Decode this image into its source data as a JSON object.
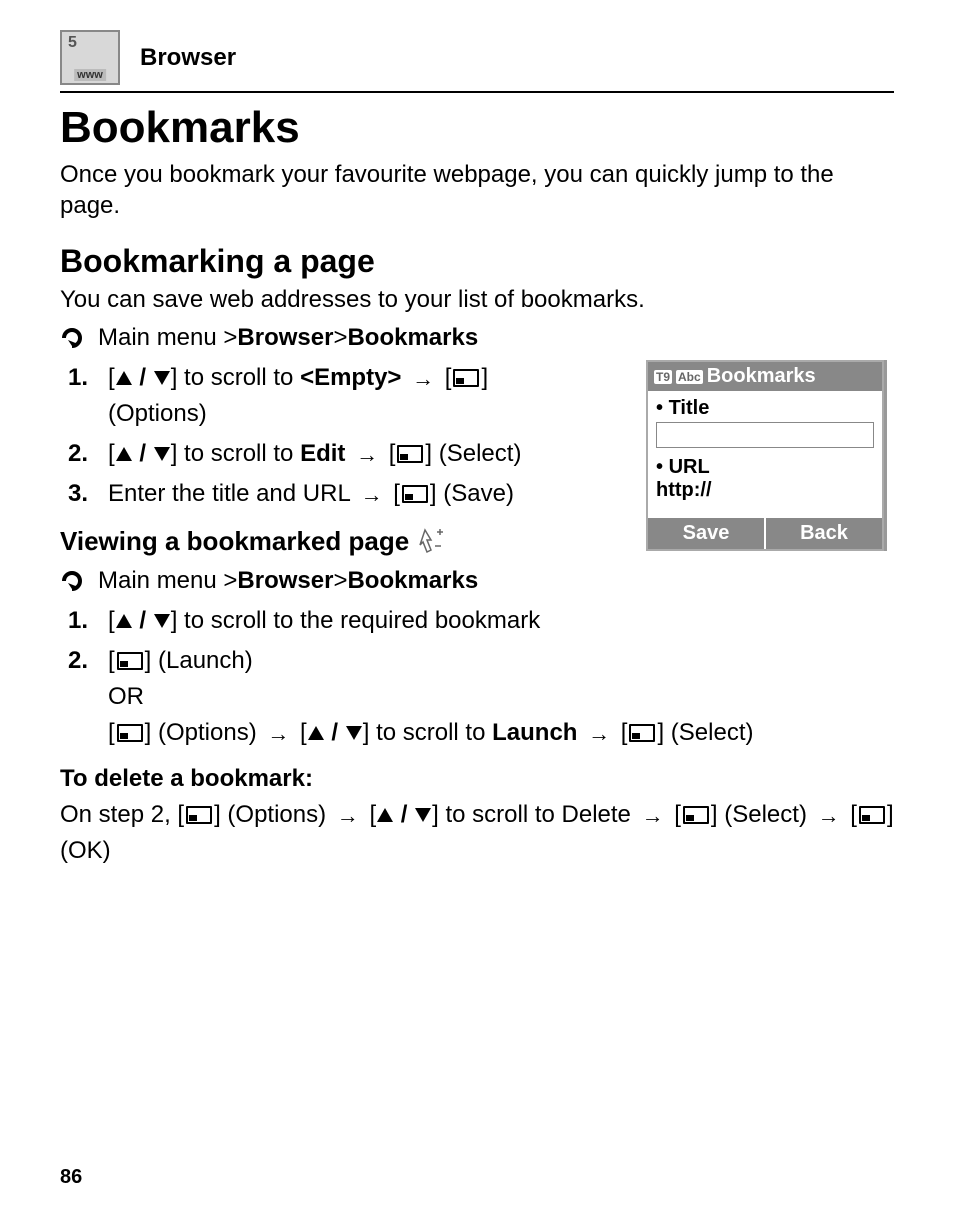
{
  "header": {
    "section": "Browser"
  },
  "title": "Bookmarks",
  "intro": "Once you bookmark your favourite webpage, you can quickly jump to the page.",
  "section1": {
    "heading": "Bookmarking a page",
    "intro": "You can save web addresses to your list of bookmarks.",
    "nav": {
      "pre": "Main menu > ",
      "b1": "Browser",
      "sep": " > ",
      "b2": "Bookmarks"
    },
    "steps": [
      {
        "num": "1.",
        "parts": [
          "[",
          "UPDOWN",
          "] to scroll to ",
          {
            "b": "<Empty>"
          },
          " ",
          "ARR",
          " [",
          "SOFT",
          "] (Options)"
        ]
      },
      {
        "num": "2.",
        "parts": [
          "[",
          "UPDOWN",
          "] to scroll to ",
          {
            "b": "Edit"
          },
          " ",
          "ARR",
          " [",
          "SOFT",
          "] (Select)"
        ]
      },
      {
        "num": "3.",
        "parts": [
          "Enter the title and URL ",
          "ARR",
          " [",
          "SOFT",
          "] (Save)"
        ]
      }
    ]
  },
  "section2": {
    "heading": "Viewing a bookmarked page",
    "nav": {
      "pre": "Main menu > ",
      "b1": "Browser",
      "sep": " > ",
      "b2": "Bookmarks"
    },
    "steps": [
      {
        "num": "1.",
        "parts": [
          "[",
          "UPDOWN",
          "] to scroll to the required bookmark"
        ]
      },
      {
        "num": "2.",
        "parts": [
          "[",
          "SOFT",
          "] (Launch)",
          "BR",
          "OR",
          "BR",
          "[",
          "SOFT",
          "] (Options) ",
          "ARR",
          " [",
          "UPDOWN",
          "] to scroll to ",
          {
            "b": "Launch"
          },
          " ",
          "ARR",
          " [",
          "SOFT",
          "] (Select)"
        ]
      }
    ]
  },
  "delete": {
    "heading": "To delete a bookmark:",
    "parts": [
      "On step 2, [",
      "SOFT",
      "] (Options) ",
      "ARR",
      " [",
      "UPDOWN",
      "] to scroll to ",
      {
        "b": "Delete"
      },
      " ",
      "ARR",
      " [",
      "SOFT",
      "] (Select) ",
      "ARR",
      " [",
      "SOFT",
      "] (OK)"
    ]
  },
  "phone": {
    "title": "Bookmarks",
    "titleLabel": "Title",
    "urlLabel": "URL",
    "urlValue": "http://",
    "softLeft": "Save",
    "softRight": "Back"
  },
  "pageNumber": "86"
}
